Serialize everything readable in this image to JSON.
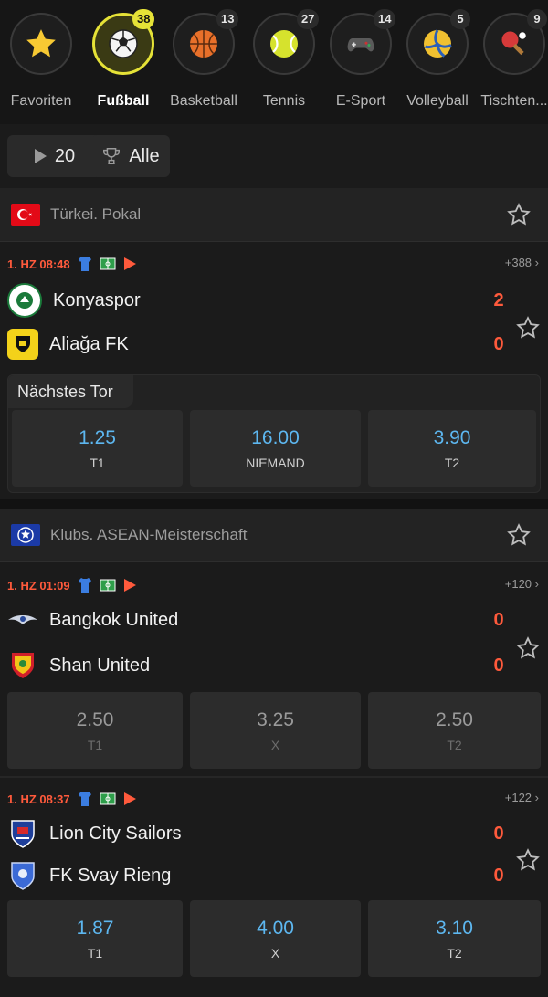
{
  "sports": [
    {
      "name": "Favoriten",
      "count": "",
      "icon": "star-icon",
      "glyph": "⭐"
    },
    {
      "name": "Fußball",
      "count": "38",
      "icon": "soccer-ball-icon",
      "glyph": "⚽"
    },
    {
      "name": "Basketball",
      "count": "13",
      "icon": "basketball-icon",
      "glyph": "🏀"
    },
    {
      "name": "Tennis",
      "count": "27",
      "icon": "tennis-ball-icon",
      "glyph": "🎾"
    },
    {
      "name": "E-Sport",
      "count": "14",
      "icon": "gamepad-icon",
      "glyph": "🎮"
    },
    {
      "name": "Volleyball",
      "count": "5",
      "icon": "volleyball-icon",
      "glyph": "🏐"
    },
    {
      "name": "Tischten...",
      "count": "9",
      "icon": "table-tennis-icon",
      "glyph": "🏓"
    }
  ],
  "filters": {
    "live_count": "20",
    "all_label": "Alle"
  },
  "leagues": [
    {
      "name": "Türkei. Pokal",
      "flag": "turkey-flag-icon",
      "matches": [
        {
          "time": "1. HZ 08:48",
          "more": "+388",
          "team1": {
            "name": "Konyaspor",
            "score": "2"
          },
          "team2": {
            "name": "Aliağa FK",
            "score": "0"
          },
          "market": "Nächstes Tor",
          "odds": [
            {
              "value": "1.25",
              "label": "T1"
            },
            {
              "value": "16.00",
              "label": "NIEMAND"
            },
            {
              "value": "3.90",
              "label": "T2"
            }
          ]
        }
      ]
    },
    {
      "name": "Klubs. ASEAN-Meisterschaft",
      "flag": "champions-league-icon",
      "matches": [
        {
          "time": "1. HZ 01:09",
          "more": "+120",
          "team1": {
            "name": "Bangkok United",
            "score": "0"
          },
          "team2": {
            "name": "Shan United",
            "score": "0"
          },
          "odds": [
            {
              "value": "2.50",
              "label": "T1"
            },
            {
              "value": "3.25",
              "label": "X"
            },
            {
              "value": "2.50",
              "label": "T2"
            }
          ]
        },
        {
          "time": "1. HZ 08:37",
          "more": "+122",
          "team1": {
            "name": "Lion City Sailors",
            "score": "0"
          },
          "team2": {
            "name": "FK Svay Rieng",
            "score": "0"
          },
          "odds": [
            {
              "value": "1.87",
              "label": "T1"
            },
            {
              "value": "4.00",
              "label": "X"
            },
            {
              "value": "3.10",
              "label": "T2"
            }
          ]
        }
      ]
    }
  ],
  "colors": {
    "accent": "#e5e237",
    "live": "#ff5a3c",
    "odds": "#5db7f0",
    "background": "#1b1b1b"
  }
}
